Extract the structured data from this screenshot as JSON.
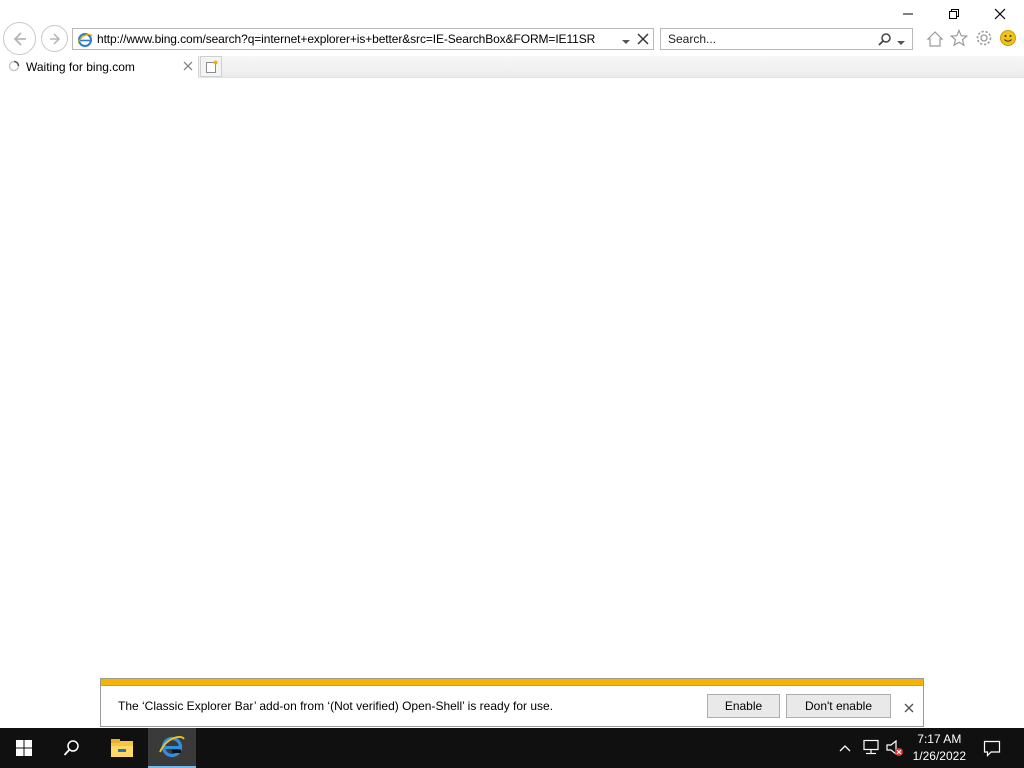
{
  "browser": {
    "address_url": "http://www.bing.com/search?q=internet+explorer+is+better&src=IE-SearchBox&FORM=IE11SR",
    "search_placeholder": "Search...",
    "tab": {
      "title": "Waiting for bing.com"
    }
  },
  "window_controls": [
    "minimize",
    "restore",
    "close"
  ],
  "toolbar_icons": [
    "home-icon",
    "favorites-star-icon",
    "tools-gear-icon",
    "feedback-smiley-icon"
  ],
  "notification": {
    "message": "The ‘Classic Explorer Bar’ add-on from ‘(Not verified) Open-Shell’ is ready for use.",
    "enable_label": "Enable",
    "dont_enable_label": "Don't enable",
    "accent_color": "#f4b400"
  },
  "taskbar": {
    "items": [
      "start-icon",
      "search-icon",
      "file-explorer-icon",
      "internet-explorer-icon"
    ],
    "time": "7:17 AM",
    "date": "1/26/2022"
  }
}
